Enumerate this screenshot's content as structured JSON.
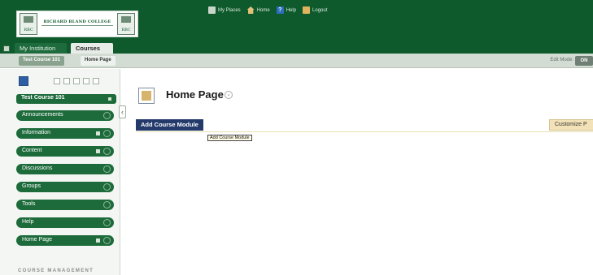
{
  "header": {
    "logo": {
      "name": "RICHARD BLAND COLLEGE",
      "seal_text": "RBC"
    },
    "topnav": [
      {
        "label": "My Places",
        "icon": "places-icon"
      },
      {
        "label": "Home",
        "icon": "home-icon"
      },
      {
        "label": "Help",
        "icon": "help-icon"
      },
      {
        "label": "Logout",
        "icon": "logout-icon"
      }
    ]
  },
  "tabs": [
    {
      "label": "My Institution",
      "active": false
    },
    {
      "label": "Courses",
      "active": true
    }
  ],
  "breadcrumb": [
    {
      "label": "Test Course 101"
    },
    {
      "label": "Home Page"
    }
  ],
  "edit_mode": {
    "label": "Edit Mode:",
    "value": "ON"
  },
  "sidebar": {
    "course_name": "Test Course 101",
    "items": [
      {
        "label": "Announcements"
      },
      {
        "label": "Information"
      },
      {
        "label": "Content"
      },
      {
        "label": "Discussions"
      },
      {
        "label": "Groups"
      },
      {
        "label": "Tools"
      },
      {
        "label": "Help"
      },
      {
        "label": "Home Page"
      }
    ],
    "management_label": "COURSE MANAGEMENT"
  },
  "main": {
    "title": "Home Page",
    "add_button": "Add Course Module",
    "customize_button": "Customize P",
    "tooltip": "Add Course Module"
  },
  "colors": {
    "header_green": "#0e5a2c",
    "menu_green": "#1d6b3b",
    "button_navy": "#243a6b",
    "customize_bg": "#f3e2b7"
  }
}
